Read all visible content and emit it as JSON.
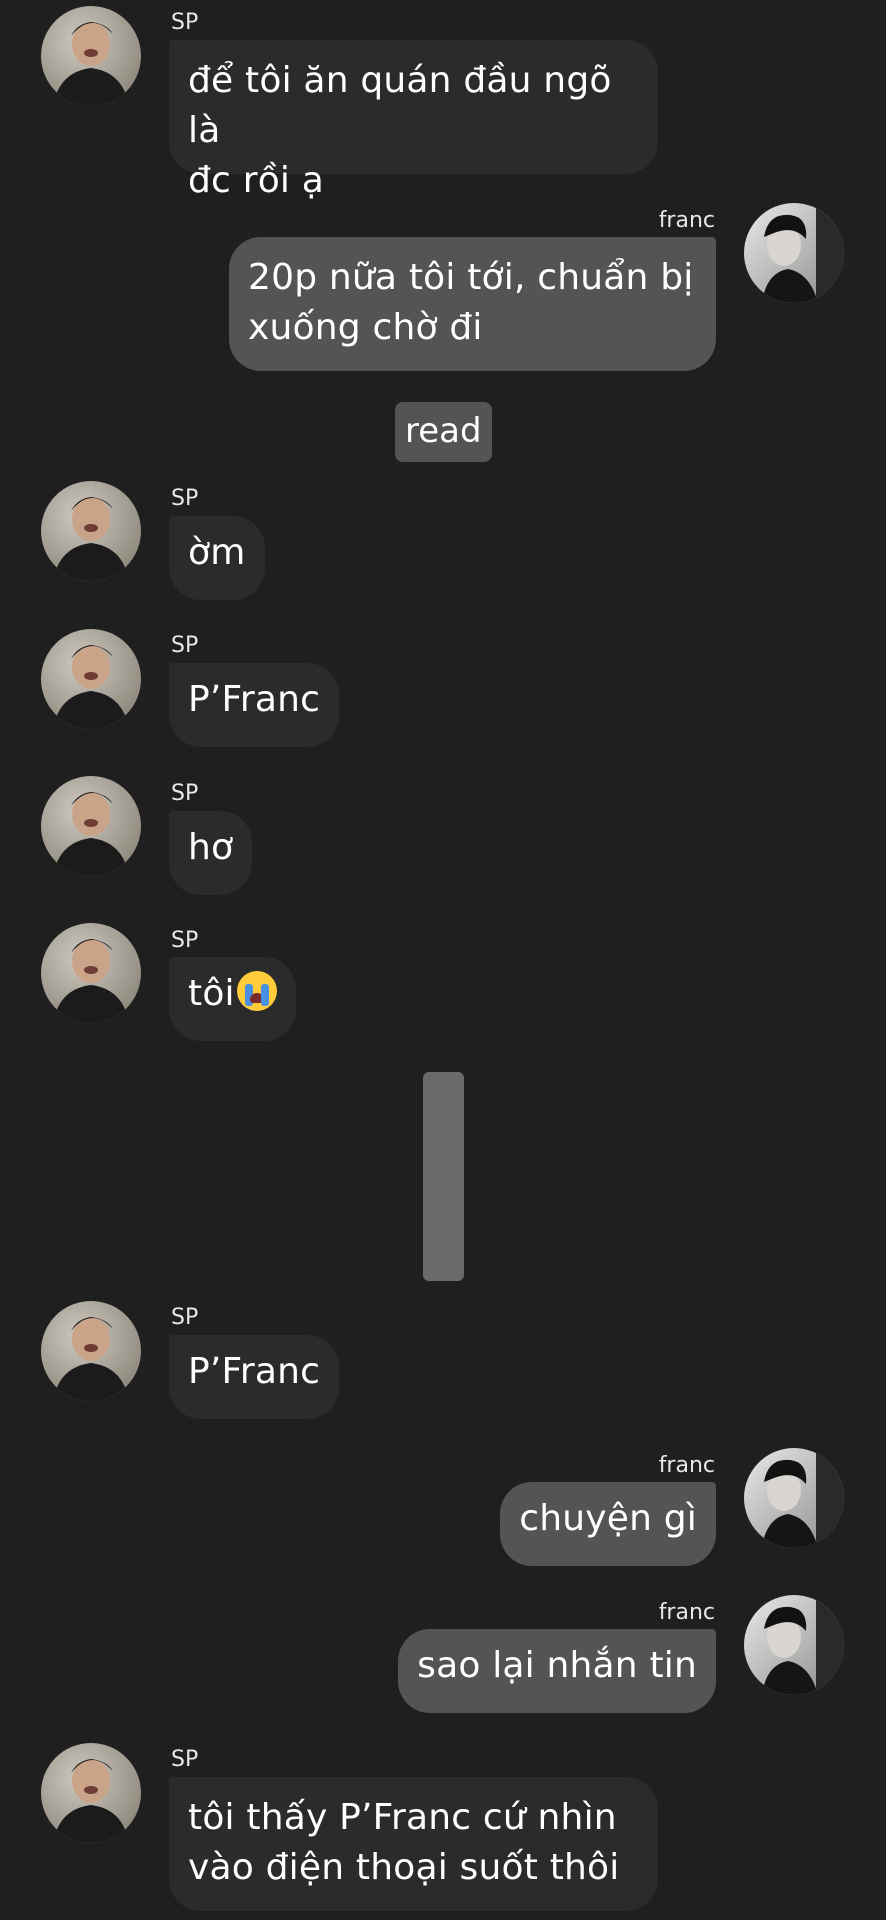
{
  "chat": {
    "read_label": "read",
    "messages": [
      {
        "sender": "SP",
        "text": "để tôi ăn quán đầu ngõ là\nđc rồi ạ"
      },
      {
        "sender": "franc",
        "text": "20p nữa tôi tới, chuẩn bị\nxuống chờ đi"
      },
      {
        "sender": "SP",
        "text": "ờm"
      },
      {
        "sender": "SP",
        "text": "P’Franc"
      },
      {
        "sender": "SP",
        "text": "hơ"
      },
      {
        "sender": "SP",
        "text": "tôi",
        "emoji": "loudly-crying-face-icon"
      },
      {
        "sender": "SP",
        "text": "P’Franc"
      },
      {
        "sender": "franc",
        "text": "chuyện gì"
      },
      {
        "sender": "franc",
        "text": "sao lại nhắn tin"
      },
      {
        "sender": "SP",
        "text": "tôi thấy P’Franc cứ nhìn\nvào điện thoại suốt thôi"
      }
    ]
  },
  "colors": {
    "background": "#1f1f1f",
    "incoming_bubble": "#2b2b2b",
    "outgoing_bubble": "#545454",
    "text": "#ffffff"
  }
}
